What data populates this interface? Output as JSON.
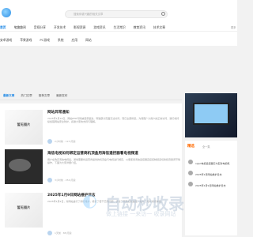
{
  "header": {
    "search_placeholder": "搜索你感兴趣的相关文章",
    "nav_top": [
      "首页",
      "笔趣趣闻",
      "音视分享",
      "开发技术",
      "影视资源",
      "游戏资讯",
      "生活常识",
      "教育资讯",
      "技术文章",
      "安卓",
      "苹果"
    ],
    "nav_bottom": [
      "安卓游戏",
      "苹果游戏",
      "PC游戏",
      "系统",
      "应用",
      "网站"
    ],
    "nav_side": "更多"
  },
  "tabs": [
    "最新文章",
    "热门文章",
    "推荐文章",
    "最新发布"
  ],
  "articles": [
    {
      "title": "网站异常通知",
      "desc": "2025年1月16日，网站PHP代码被恶意篡改，导致部分页面无法访问，现已全部修复。为保障广大用户的正常访问，我们将持续加强网站安全防护，感谢大家的支持与理解。",
      "meta": "2小时前 · 123 阅读",
      "thumb_text": "暂无图片"
    },
    {
      "title": "海信电视如何绑定运营商机顶盒用海信遥控器看电视频道",
      "desc": "用户在购买海信电视后，通常需要将运营商提供的机顶盒与电视进行绑定，以便使用海信遥控器直接控制频道切换和音量调节等操作，下面为大家详细介绍。",
      "meta": "3小时前 · 256 阅读",
      "thumb_text": ""
    },
    {
      "title": "2025年1月9日网站维护日志",
      "desc": "2025年1月9日，对网站进行了例行维护，修复了若干已知问题，优化了页面加载速度，提升了用户浏览体验。",
      "meta": "1天前 · 88 阅读",
      "thumb_text": "暂无图片"
    }
  ],
  "hot": {
    "title": "精选",
    "sub": "全一集",
    "items": [
      "oppo电视遥控器怎么配对电视机",
      "2025年1月网站维护日志",
      "2025年1月9日网站维护日志"
    ]
  },
  "watermark": {
    "title": "自动秒收录",
    "sub": "做上链接 一来访一 收录网站"
  }
}
